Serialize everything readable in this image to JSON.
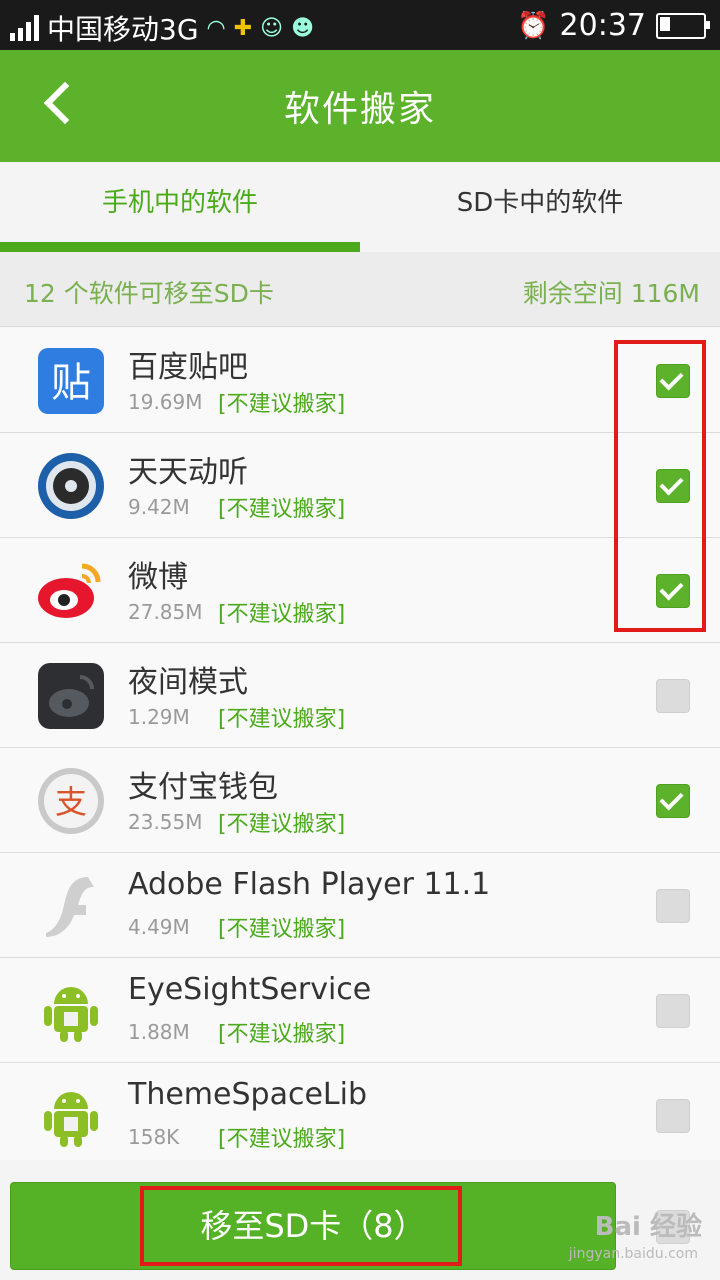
{
  "status_bar": {
    "carrier": "中国移动3G",
    "time": "20:37"
  },
  "header": {
    "title": "软件搬家"
  },
  "tabs": [
    {
      "label": "手机中的软件",
      "active": true
    },
    {
      "label": "SD卡中的软件",
      "active": false
    }
  ],
  "summary": {
    "left": "12 个软件可移至SD卡",
    "right": "剩余空间 116M"
  },
  "apps": [
    {
      "name": "百度贴吧",
      "size": "19.69M",
      "note": "[不建议搬家]",
      "checked": true,
      "icon": "baidu-tieba-icon"
    },
    {
      "name": "天天动听",
      "size": "9.42M",
      "note": "[不建议搬家]",
      "checked": true,
      "icon": "ttpod-icon"
    },
    {
      "name": "微博",
      "size": "27.85M",
      "note": "[不建议搬家]",
      "checked": true,
      "icon": "weibo-icon"
    },
    {
      "name": "夜间模式",
      "size": "1.29M",
      "note": "[不建议搬家]",
      "checked": false,
      "icon": "night-mode-icon"
    },
    {
      "name": "支付宝钱包",
      "size": "23.55M",
      "note": "[不建议搬家]",
      "checked": true,
      "icon": "alipay-icon"
    },
    {
      "name": "Adobe Flash Player 11.1",
      "size": "4.49M",
      "note": "[不建议搬家]",
      "checked": false,
      "icon": "flash-icon"
    },
    {
      "name": "EyeSightService",
      "size": "1.88M",
      "note": "[不建议搬家]",
      "checked": false,
      "icon": "android-icon"
    },
    {
      "name": "ThemeSpaceLib",
      "size": "158K",
      "note": "[不建议搬家]",
      "checked": false,
      "icon": "android-icon"
    }
  ],
  "bottom": {
    "move_button": "移至SD卡（8）",
    "watermark": "Bai 经验",
    "watermark_url": "jingyan.baidu.com"
  },
  "colors": {
    "accent": "#5cb22a",
    "highlight": "#e21a1a"
  }
}
